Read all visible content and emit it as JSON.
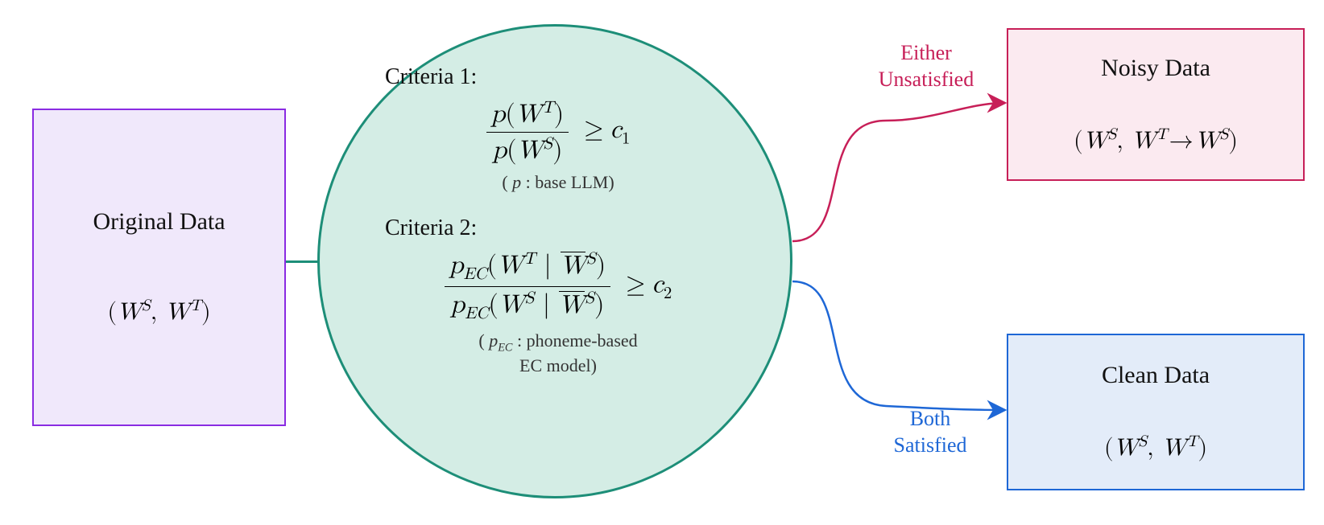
{
  "original": {
    "title": "Original Data",
    "expr_prefix": "(",
    "expr_w1": "W",
    "expr_sup1": "S",
    "expr_sep": ", ",
    "expr_w2": "W",
    "expr_sup2": "T",
    "expr_suffix": ")"
  },
  "noisy": {
    "title": "Noisy Data",
    "expr_prefix": "(",
    "expr_w1": "W",
    "expr_sup1": "S",
    "expr_sep": ", ",
    "expr_w2": "W",
    "expr_sup2": "T",
    "expr_arrow": "→",
    "expr_w3": "W",
    "expr_sup3": "S",
    "expr_suffix": ")"
  },
  "clean": {
    "title": "Clean Data",
    "expr_prefix": "(",
    "expr_w1": "W",
    "expr_sup1": "S",
    "expr_sep": ", ",
    "expr_w2": "W",
    "expr_sup2": "T",
    "expr_suffix": ")"
  },
  "criteria1": {
    "heading": "Criteria 1:",
    "num_p": "p",
    "num_open": "(",
    "num_W": "W",
    "num_sup": "T",
    "num_close": ")",
    "den_p": "p",
    "den_open": "(",
    "den_W": "W",
    "den_sup": "S",
    "den_close": ")",
    "ge": "≥",
    "c": "c",
    "csub": "1",
    "note_open": "( ",
    "note_p": "p",
    "note_txt": " : base LLM)",
    "note_close": ""
  },
  "criteria2": {
    "heading": "Criteria 2:",
    "num_p": "p",
    "num_psub": "EC",
    "num_open": "(",
    "num_W": "W",
    "num_sup": "T",
    "num_bar": " | ",
    "num_Wb": "W",
    "num_Wb_sup": "S",
    "num_close": ")",
    "den_p": "p",
    "den_psub": "EC",
    "den_open": "(",
    "den_W": "W",
    "den_sup": "S",
    "den_bar": " | ",
    "den_Wb": "W",
    "den_Wb_sup": "S",
    "den_close": ")",
    "ge": "≥",
    "c": "c",
    "csub": "2",
    "note_open": "( ",
    "note_p": "p",
    "note_psub": "EC",
    "note_line1": " : phoneme-based",
    "note_line2": "EC model)"
  },
  "edges": {
    "unsat_l1": "Either",
    "unsat_l2": "Unsatisfied",
    "sat_l1": "Both",
    "sat_l2": "Satisfied"
  },
  "colors": {
    "purple_border": "#8a2be2",
    "purple_fill": "#f0e8fb",
    "teal_border": "#1d8e78",
    "teal_fill": "#d4ede5",
    "magenta_border": "#c71f58",
    "magenta_fill": "#fbeaf0",
    "blue_border": "#1e67d6",
    "blue_fill": "#e3ecf9"
  }
}
